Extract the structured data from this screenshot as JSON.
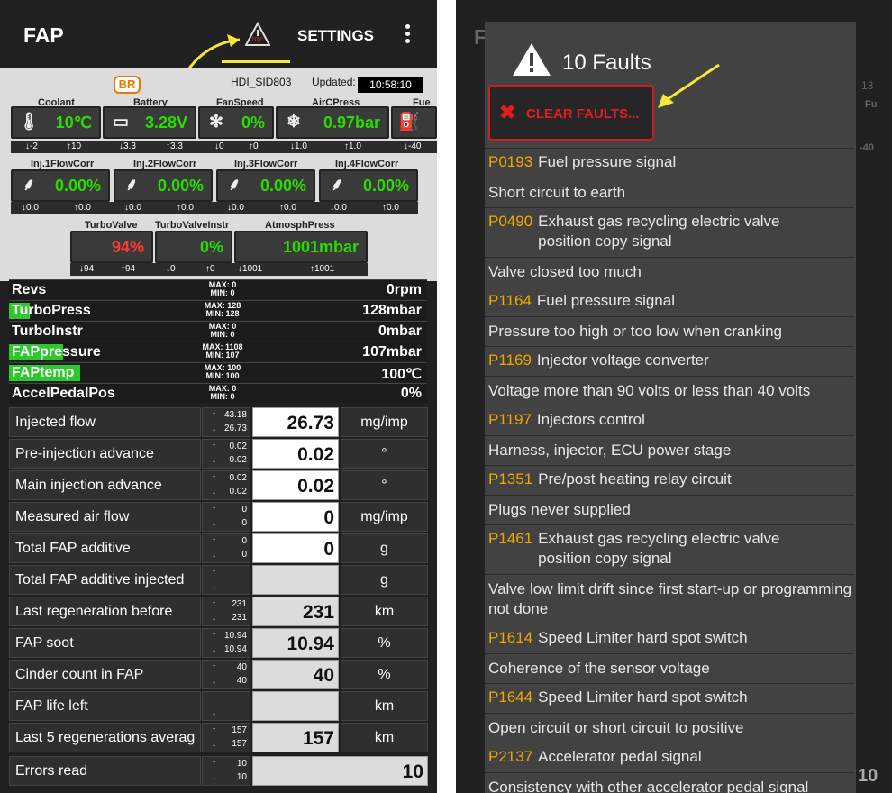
{
  "left": {
    "appbar": {
      "title": "FAP",
      "settings": "SETTINGS"
    },
    "header": {
      "badge": "BR",
      "ecu": "HDI_SID803",
      "updated_label": "Updated:",
      "updated_time": "10:58:10"
    },
    "gauges_row1": [
      {
        "label": "Coolant",
        "icon": "thermometer-icon",
        "value": "10℃",
        "min": "-2",
        "max": "10"
      },
      {
        "label": "Battery",
        "icon": "battery-icon",
        "value": "3.28V",
        "min": "3.3",
        "max": "3.3"
      },
      {
        "label": "FanSpeed",
        "icon": "fan-icon",
        "value": "0%",
        "min": "0",
        "max": "0"
      },
      {
        "label": "AirCPress",
        "icon": "snowflake-icon",
        "value": "0.97bar",
        "min": "1.0",
        "max": "1.0"
      },
      {
        "label": "Fue",
        "icon": "fuel-icon",
        "value": "",
        "min": "-40",
        "max": ""
      }
    ],
    "gauges_row2": [
      {
        "label": "Inj.1FlowCorr",
        "icon": "injector-icon",
        "value": "0.00%",
        "min": "0.0",
        "max": "0.0"
      },
      {
        "label": "Inj.2FlowCorr",
        "icon": "injector-icon",
        "value": "0.00%",
        "min": "0.0",
        "max": "0.0"
      },
      {
        "label": "Inj.3FlowCorr",
        "icon": "injector-icon",
        "value": "0.00%",
        "min": "0.0",
        "max": "0.0"
      },
      {
        "label": "Inj.4FlowCorr",
        "icon": "injector-icon",
        "value": "0.00%",
        "min": "0.0",
        "max": "0.0"
      }
    ],
    "gauges_row3": [
      {
        "label": "TurboValve",
        "value": "94%",
        "min": "94",
        "max": "94",
        "color": "#ff3b2f"
      },
      {
        "label": "TurboValveInstr",
        "value": "0%",
        "min": "0",
        "max": "0",
        "color": "#2bdc00"
      },
      {
        "label": "AtmosphPress",
        "value": "1001mbar",
        "min": "1001",
        "max": "1001",
        "color": "#2bdc00"
      }
    ],
    "bars": [
      {
        "label": "Revs",
        "max": "MAX: 0",
        "min": "MIN: 0",
        "value": "0rpm",
        "fill_fraction": 0
      },
      {
        "label": "TurboPress",
        "max": "MAX: 128",
        "min": "MIN: 128",
        "value": "128mbar",
        "fill_fraction": 0.05
      },
      {
        "label": "TurboInstr",
        "max": "MAX: 0",
        "min": "MIN: 0",
        "value": "0mbar",
        "fill_fraction": 0
      },
      {
        "label": "FAPpressure",
        "max": "MAX: 1108",
        "min": "MIN: 107",
        "value": "107mbar",
        "fill_fraction": 0.13
      },
      {
        "label": "FAPtemp",
        "max": "MAX: 100",
        "min": "MIN: 100",
        "value": "100℃",
        "fill_fraction": 0.17
      },
      {
        "label": "AccelPedalPos",
        "max": "MAX: 0",
        "min": "MIN: 0",
        "value": "0%",
        "fill_fraction": 0
      }
    ],
    "rows": [
      {
        "name": "Injected flow",
        "max": "43.18",
        "min": "26.73",
        "value": "26.73",
        "unit": "mg/imp"
      },
      {
        "name": "Pre-injection advance",
        "max": "0.02",
        "min": "0.02",
        "value": "0.02",
        "unit": "°"
      },
      {
        "name": "Main injection advance",
        "max": "0.02",
        "min": "0.02",
        "value": "0.02",
        "unit": "°"
      },
      {
        "name": "Measured air flow",
        "max": "0",
        "min": "0",
        "value": "0",
        "unit": "mg/imp"
      },
      {
        "name": "Total FAP additive",
        "max": "0",
        "min": "0",
        "value": "0",
        "unit": "g"
      },
      {
        "name": "Total FAP additive injected",
        "max": "",
        "min": "",
        "value": "",
        "unit": "g"
      },
      {
        "name": "Last regeneration before",
        "max": "231",
        "min": "231",
        "value": "231",
        "unit": "km"
      },
      {
        "name": "FAP soot",
        "max": "10.94",
        "min": "10.94",
        "value": "10.94",
        "unit": "%"
      },
      {
        "name": "Cinder count in FAP",
        "max": "40",
        "min": "40",
        "value": "40",
        "unit": "%"
      },
      {
        "name": "FAP life left",
        "max": "",
        "min": "",
        "value": "",
        "unit": "km"
      },
      {
        "name": "Last 5 regenerations averag",
        "max": "157",
        "min": "157",
        "value": "157",
        "unit": "km"
      },
      {
        "name": "Errors read",
        "max": "10",
        "min": "10",
        "value": "10",
        "unit": ""
      }
    ]
  },
  "right": {
    "dialog": {
      "title": "10 Faults",
      "clear_label": "CLEAR FAULTS..."
    },
    "faults": [
      {
        "code": "P0193",
        "text": "Fuel pressure signal",
        "detail": "Short circuit to earth"
      },
      {
        "code": "P0490",
        "text": "Exhaust gas recycling electric valve position copy signal",
        "detail": "Valve closed too much"
      },
      {
        "code": "P1164",
        "text": "Fuel pressure signal",
        "detail": "Pressure too high or too low when cranking"
      },
      {
        "code": "P1169",
        "text": "Injector voltage converter",
        "detail": "Voltage more than 90 volts or less than 40 volts"
      },
      {
        "code": "P1197",
        "text": "Injectors control",
        "detail": "Harness, injector, ECU power stage"
      },
      {
        "code": "P1351",
        "text": "Pre/post heating relay circuit",
        "detail": "Plugs never supplied"
      },
      {
        "code": "P1461",
        "text": "Exhaust gas recycling electric valve position copy signal",
        "detail": "Valve low limit drift since first start-up or programming not done"
      },
      {
        "code": "P1614",
        "text": "Speed Limiter hard spot switch",
        "detail": "Coherence of the sensor voltage"
      },
      {
        "code": "P1644",
        "text": "Speed Limiter hard spot switch",
        "detail": "Open circuit or short circuit to positive"
      },
      {
        "code": "P2137",
        "text": "Accelerator pedal signal",
        "detail": "Consistency with other accelerator pedal signal"
      }
    ],
    "background_partial": {
      "title": "F",
      "bg_time": "13",
      "bg_label": "Fu",
      "bg_val": "-40",
      "bg_errors": "10"
    }
  },
  "colors": {
    "accent_green": "#2bdc00",
    "alert_red": "#ff3b2f",
    "fault_code": "#f0a800",
    "annotation_yellow": "#f7e636"
  }
}
